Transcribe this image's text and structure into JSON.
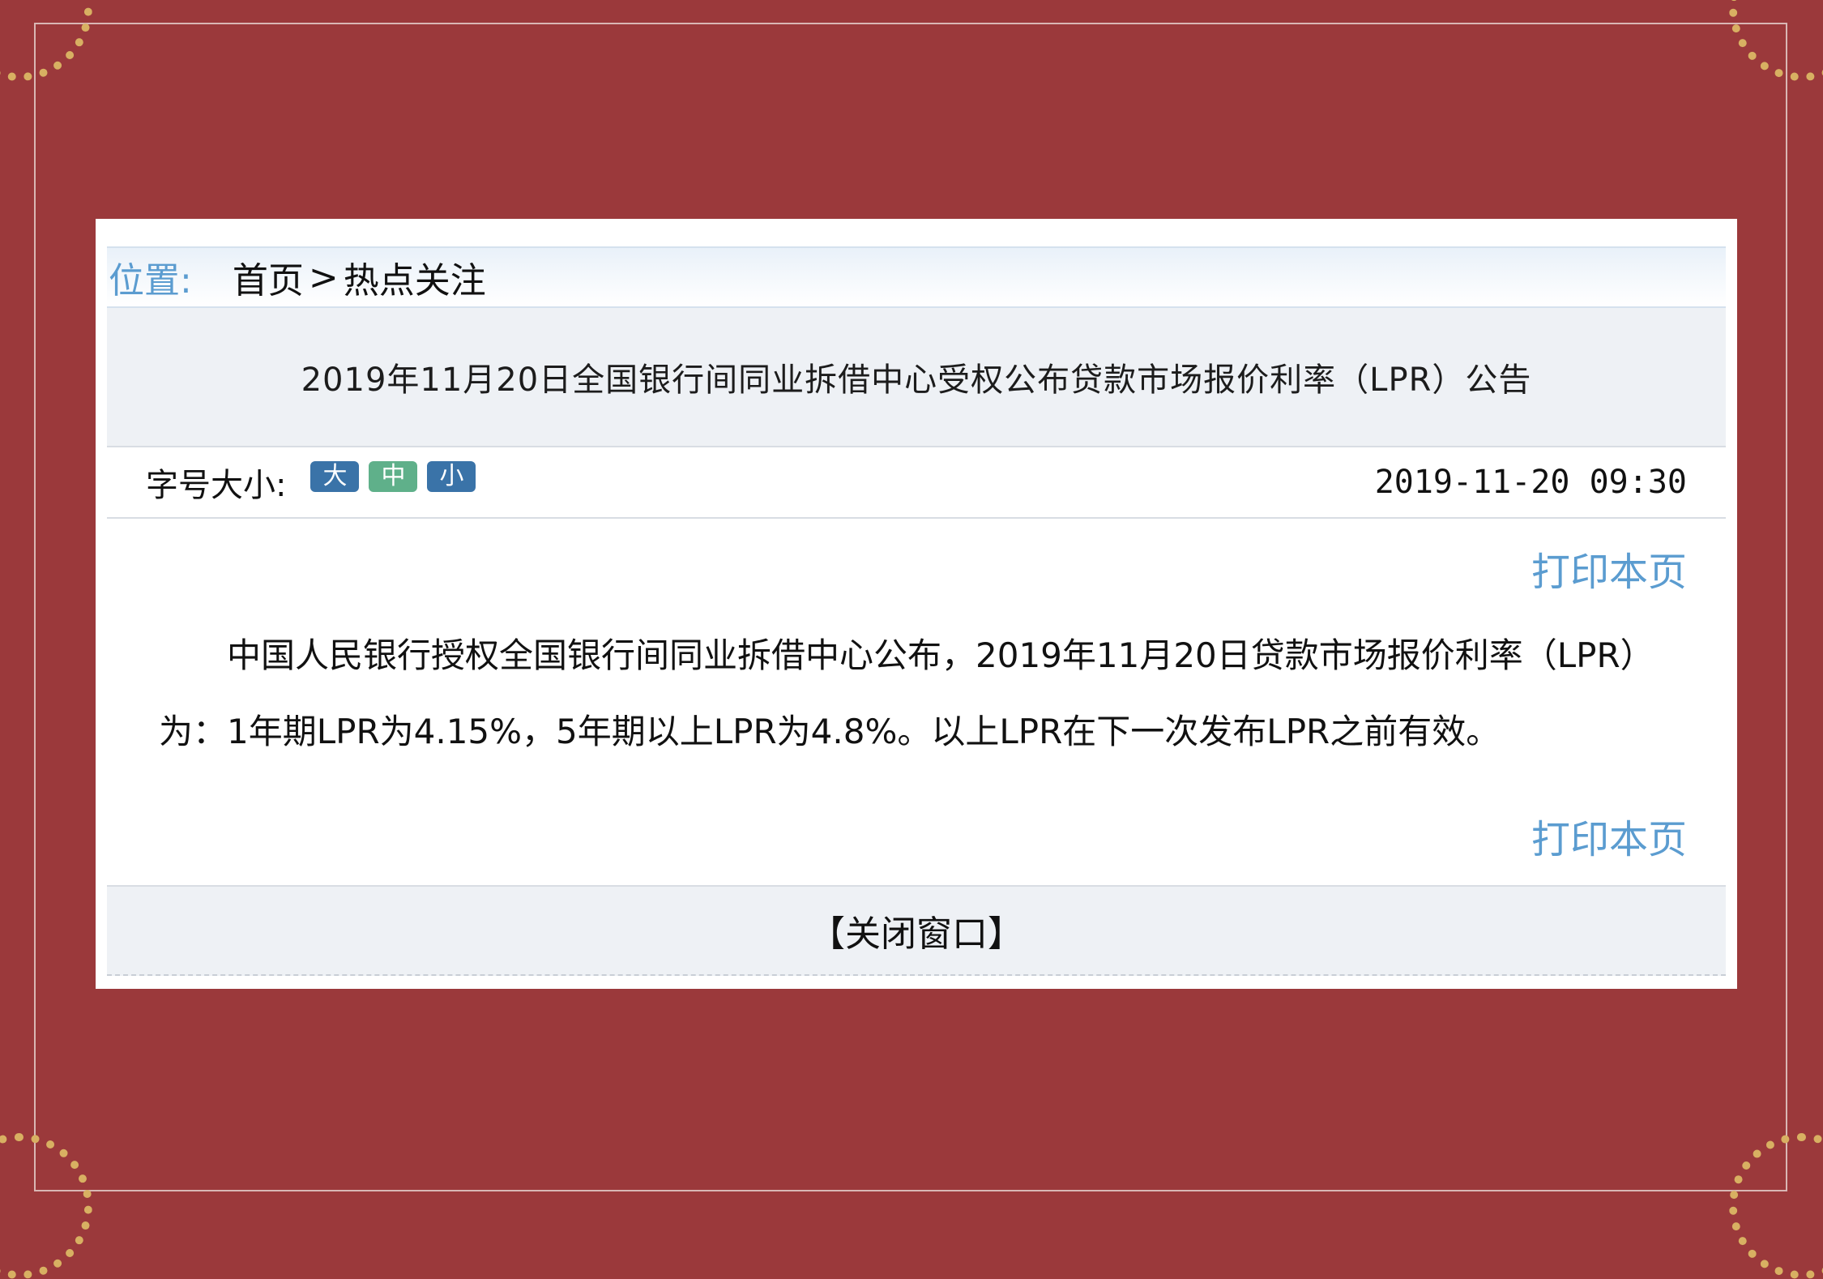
{
  "breadcrumb": {
    "label": "位置:",
    "home": "首页",
    "separator": ">",
    "current": "热点关注"
  },
  "article": {
    "title": "2019年11月20日全国银行间同业拆借中心受权公布贷款市场报价利率（LPR）公告",
    "date": "2019-11-20 09:30",
    "body": "中国人民银行授权全国银行间同业拆借中心公布，2019年11月20日贷款市场报价利率（LPR）为：1年期LPR为4.15%，5年期以上LPR为4.8%。以上LPR在下一次发布LPR之前有效。"
  },
  "font_size": {
    "label": "字号大小:",
    "large": "大",
    "medium": "中",
    "small": "小"
  },
  "print_label": "打印本页",
  "close_label": "【关闭窗口】",
  "colors": {
    "background": "#9b393b",
    "link": "#5b9cd0",
    "button_blue": "#3a73a8",
    "button_green": "#5fb08a"
  }
}
